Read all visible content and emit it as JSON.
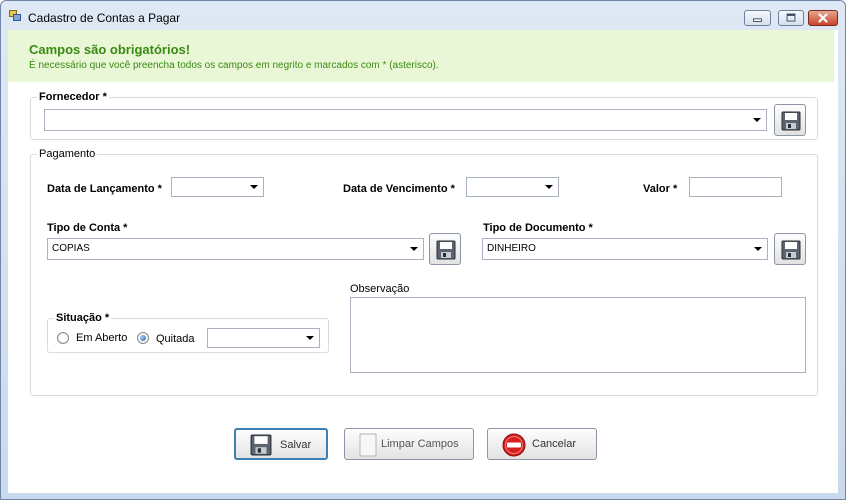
{
  "window": {
    "title": "Cadastro de Contas a Pagar",
    "icons": {
      "app": "app-form-icon",
      "minimize": "minimize-icon",
      "maximize": "maximize-icon",
      "close": "close-icon"
    }
  },
  "banner": {
    "title": "Campos são obrigatórios!",
    "text": "É necessário que você preencha todos os campos em negrito e marcados com * (asterisco).",
    "color": "#3a8a12",
    "background": "#e9f7d6"
  },
  "fornecedor": {
    "label": "Fornecedor *",
    "value": "",
    "button_icon": "save-disk-icon"
  },
  "pagamento": {
    "label": "Pagamento",
    "data_lancamento": {
      "label": "Data de Lançamento *",
      "value": ""
    },
    "data_vencimento": {
      "label": "Data de Vencimento *",
      "value": ""
    },
    "valor": {
      "label": "Valor *",
      "value": ""
    },
    "tipo_conta": {
      "label": "Tipo de Conta *",
      "value": "COPIAS",
      "button_icon": "save-disk-icon"
    },
    "tipo_documento": {
      "label": "Tipo de Documento *",
      "value": "DINHEIRO",
      "button_icon": "save-disk-icon"
    },
    "situacao": {
      "label": "Situação *",
      "options": [
        {
          "label": "Em Aberto",
          "checked": false
        },
        {
          "label": "Quitada",
          "checked": true
        }
      ],
      "date_value": ""
    },
    "observacao": {
      "label": "Observação",
      "value": ""
    }
  },
  "actions": {
    "save": {
      "label": "Salvar",
      "icon": "save-disk-icon"
    },
    "clear": {
      "label": "Limpar Campos",
      "icon": "blank-page-icon"
    },
    "cancel": {
      "label": "Cancelar",
      "icon": "no-entry-icon"
    }
  }
}
